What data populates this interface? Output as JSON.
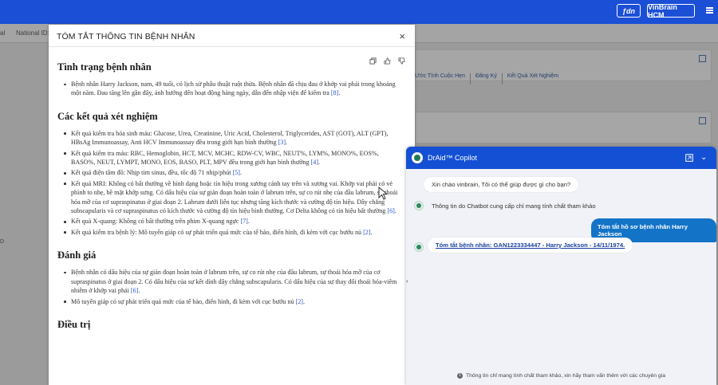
{
  "topbar": {
    "lang_label": "ƒdn",
    "org_label": "VinBrain HCM"
  },
  "background": {
    "row_left_text": "al",
    "row_national_id": "National ID: N",
    "links": [
      "Ước Tính Cuộc Hẹn",
      "Đăng Ký",
      "Kết Quả Xét Nghiệm"
    ],
    "left_stub": "D"
  },
  "modal": {
    "title": "TÓM TẮT THÔNG TIN BỆNH NHÂN",
    "close_label": "×",
    "sections": [
      {
        "title": "Tình trạng bệnh nhân",
        "items": [
          {
            "text": "Bệnh nhân Harry Jackson, nam, 49 tuổi, có lịch sử phẫu thuật ruột thừa. Bệnh nhân đã chịu đau ở khớp vai phải trong khoảng một năm. Đau tăng lên gần đây, ảnh hưởng đến hoạt động hàng ngày, dẫn đến nhập viện để kiểm tra",
            "ref": "[8]",
            "end": "."
          }
        ]
      },
      {
        "title": "Các kết quả xét nghiệm",
        "items": [
          {
            "text": "Kết quả kiểm tra hóa sinh máu: Glucose, Urea, Creatinine, Uric Acid, Cholesterol, Triglycerides, AST (GOT), ALT (GPT), HBsAg Immunoassay, Anti HCV Immunoassay đều trong giới hạn bình thường",
            "ref": "[3]",
            "end": "."
          },
          {
            "text": "Kết quả kiểm tra máu: RBC, Hemoglobin, HCT, MCV, MCHC, RDW-CV, WBC, NEUT%, LYM%, MONO%, EOS%, BASO%, NEUT, LYMPT, MONO, EOS, BASO, PLT, MPV đều trong giới hạn bình thường",
            "ref": "[4]",
            "end": "."
          },
          {
            "text": "Kết quả điện tâm đồ: Nhịp tim sinus, đều, tốc độ 71 nhịp/phút",
            "ref": "[5]",
            "end": "."
          },
          {
            "text": "Kết quả MRI: Không có bất thường về hình dạng hoặc tín hiệu trong xương cánh tay trên và xương vai. Khớp vai phải có vẻ phình to nhẹ, bề mặt khớp sưng. Có dấu hiệu của sự gián đoạn hoàn toàn ở labrum trên, sự co rút nhẹ của đầu labrum, sự thoái hóa mỡ của cơ supraspinatus ở giai đoạn 2. Labrum dưới liên tục nhưng tăng kích thước và cường độ tín hiệu. Dây chằng subscapularis và cơ supraspinatus có kích thước và cường độ tín hiệu bình thường. Cơ Delta không có tín hiệu bất thường",
            "ref": "[6]",
            "end": "."
          },
          {
            "text": "Kết quả X-quang: Không có bất thường trên phim X-quang ngực",
            "ref": "[7]",
            "end": "."
          },
          {
            "text": "Kết quả kiểm tra bệnh lý: Mô tuyến giáp có sự phát triển quá mức của tế bào, điển hình, đi kèm với cục bướu nủ",
            "ref": "[2]",
            "end": "."
          }
        ]
      },
      {
        "title": "Đánh giá",
        "items": [
          {
            "text": "Bệnh nhân có dấu hiệu của sự gián đoạn hoàn toàn ở labrum trên, sự co rút nhẹ của đầu labrum, sự thoái hóa mỡ của cơ supraspinatus ở giai đoạn 2. Có dấu hiệu của sự kết dính dây chằng subscapularis. Có dấu hiệu của sự thay đổi thoái hóa-viêm nhiễm ở khớp vai phải",
            "ref": "[6]",
            "end": "."
          },
          {
            "text": "Mô tuyến giáp có sự phát triển quá mức của tế bào, điển hình, đi kèm với cục bướu nủ",
            "ref": "[2]",
            "end": "."
          }
        ]
      },
      {
        "title": "Điều trị",
        "items": []
      }
    ]
  },
  "copilot": {
    "title": "DrAid™ Copilot",
    "messages": {
      "greeting": "Xin chào vinbrain, Tôi có thể giúp được gì cho bạn?",
      "disclaimer": "Thông tin do Chatbot cung cấp chỉ mang tính chất tham khảo",
      "user_request": "Tóm tắt hồ sơ bệnh nhân Harry Jackson",
      "summary_link": "Tóm tắt bệnh nhân: GAN1223334447 - Harry Jackson - 14/11/1974."
    },
    "footer_note": "Thông tin chỉ mang tính chất tham khảo, xin hãy tham vấn thêm với các chuyên gia"
  },
  "colors": {
    "brand_blue": "#1b4fd6",
    "user_bubble": "#1373c7",
    "link": "#2a54c9"
  }
}
